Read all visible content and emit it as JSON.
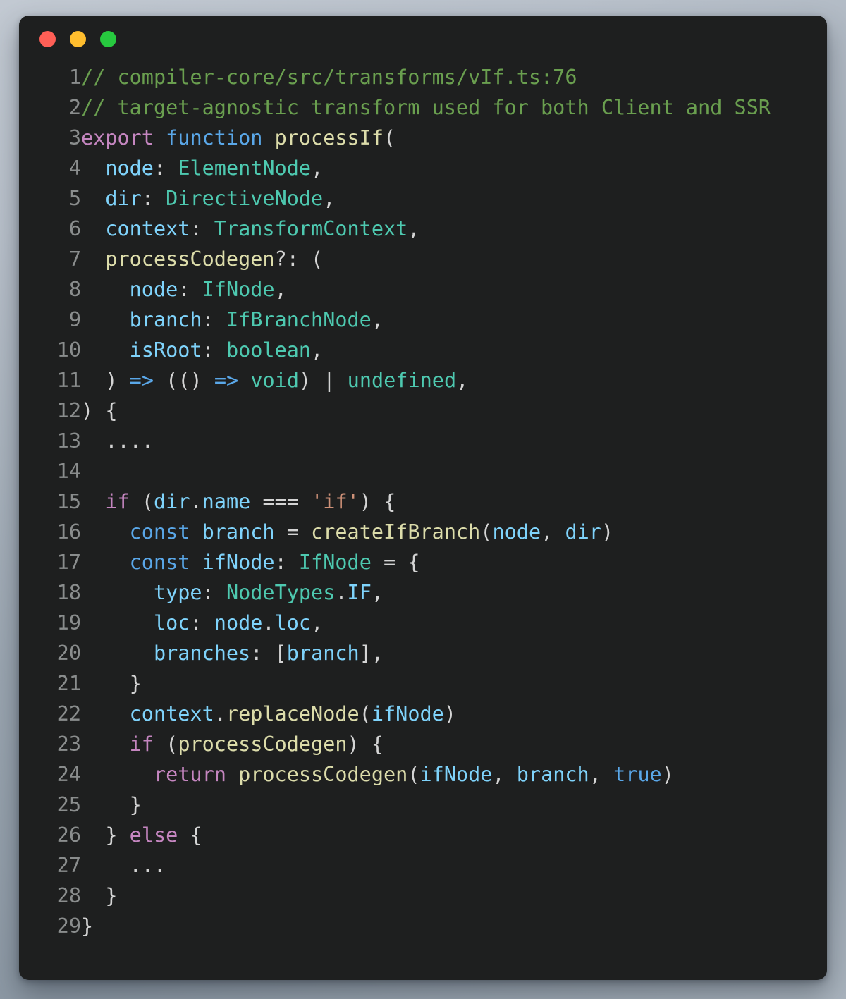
{
  "window": {
    "traffic_lights": [
      {
        "name": "close",
        "color": "#ff5f56"
      },
      {
        "name": "minimize",
        "color": "#ffbd2e"
      },
      {
        "name": "maximize",
        "color": "#27c93f"
      }
    ],
    "background_color": "#1e1f1f"
  },
  "editor": {
    "language": "typescript",
    "theme_colors": {
      "comment": "#6a9f4f",
      "keyword": "#c586c0",
      "keyword_alt": "#5aa7e8",
      "function": "#dcdcaa",
      "variable": "#7fd3fb",
      "type": "#4ec9b0",
      "string": "#ce9178",
      "punctuation": "#d4d4d4",
      "line_number": "#8a8d8d"
    },
    "line_numbers": [
      "1",
      "2",
      "3",
      "4",
      "5",
      "6",
      "7",
      "8",
      "9",
      "10",
      "11",
      "12",
      "13",
      "14",
      "15",
      "16",
      "17",
      "18",
      "19",
      "20",
      "21",
      "22",
      "23",
      "24",
      "25",
      "26",
      "27",
      "28",
      "29"
    ],
    "lines": [
      {
        "n": "1",
        "text": "// compiler-core/src/transforms/vIf.ts:76"
      },
      {
        "n": "2",
        "text": "// target-agnostic transform used for both Client and SSR"
      },
      {
        "n": "3",
        "text": "export function processIf("
      },
      {
        "n": "4",
        "text": "  node: ElementNode,"
      },
      {
        "n": "5",
        "text": "  dir: DirectiveNode,"
      },
      {
        "n": "6",
        "text": "  context: TransformContext,"
      },
      {
        "n": "7",
        "text": "  processCodegen?: ("
      },
      {
        "n": "8",
        "text": "    node: IfNode,"
      },
      {
        "n": "9",
        "text": "    branch: IfBranchNode,"
      },
      {
        "n": "10",
        "text": "    isRoot: boolean,"
      },
      {
        "n": "11",
        "text": "  ) => (() => void) | undefined,"
      },
      {
        "n": "12",
        "text": ") {"
      },
      {
        "n": "13",
        "text": "  ...."
      },
      {
        "n": "14",
        "text": ""
      },
      {
        "n": "15",
        "text": "  if (dir.name === 'if') {"
      },
      {
        "n": "16",
        "text": "    const branch = createIfBranch(node, dir)"
      },
      {
        "n": "17",
        "text": "    const ifNode: IfNode = {"
      },
      {
        "n": "18",
        "text": "      type: NodeTypes.IF,"
      },
      {
        "n": "19",
        "text": "      loc: node.loc,"
      },
      {
        "n": "20",
        "text": "      branches: [branch],"
      },
      {
        "n": "21",
        "text": "    }"
      },
      {
        "n": "22",
        "text": "    context.replaceNode(ifNode)"
      },
      {
        "n": "23",
        "text": "    if (processCodegen) {"
      },
      {
        "n": "24",
        "text": "      return processCodegen(ifNode, branch, true)"
      },
      {
        "n": "25",
        "text": "    }"
      },
      {
        "n": "26",
        "text": "  } else {"
      },
      {
        "n": "27",
        "text": "    ..."
      },
      {
        "n": "28",
        "text": "  }"
      },
      {
        "n": "29",
        "text": "}"
      }
    ]
  }
}
